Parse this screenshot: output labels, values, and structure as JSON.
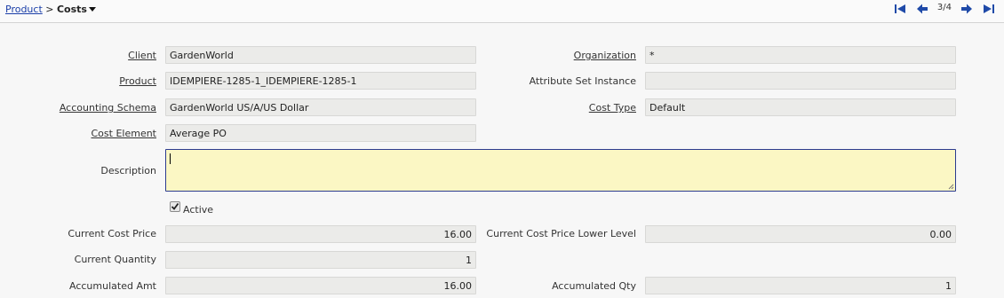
{
  "breadcrumb": {
    "parent": "Product",
    "separator": ">",
    "current": "Costs"
  },
  "navigation": {
    "record_count": "3/4"
  },
  "form": {
    "client": {
      "label": "Client",
      "value": "GardenWorld"
    },
    "organization": {
      "label": "Organization",
      "value": "*"
    },
    "product": {
      "label": "Product",
      "value": "IDEMPIERE-1285-1_IDEMPIERE-1285-1"
    },
    "attribute_set_instance": {
      "label": "Attribute Set Instance",
      "value": ""
    },
    "accounting_schema": {
      "label": "Accounting Schema",
      "value": "GardenWorld US/A/US Dollar"
    },
    "cost_type": {
      "label": "Cost Type",
      "value": "Default"
    },
    "cost_element": {
      "label": "Cost Element",
      "value": "Average PO"
    },
    "description": {
      "label": "Description",
      "value": ""
    },
    "active": {
      "label": "Active",
      "checked": true
    },
    "current_cost_price": {
      "label": "Current Cost Price",
      "value": "16.00"
    },
    "current_cost_price_lower_level": {
      "label": "Current Cost Price Lower Level",
      "value": "0.00"
    },
    "current_quantity": {
      "label": "Current Quantity",
      "value": "1"
    },
    "accumulated_amt": {
      "label": "Accumulated Amt",
      "value": "16.00"
    },
    "accumulated_qty": {
      "label": "Accumulated Qty",
      "value": "1"
    }
  },
  "colors": {
    "link": "#1a3ea8",
    "field_bg": "#ebebe9",
    "description_bg": "#fbf7c4",
    "focus_border": "#2b3a8f",
    "nav_icon": "#1f4aa8"
  },
  "icons": {
    "first": "first-record-icon",
    "prev": "previous-record-icon",
    "next": "next-record-icon",
    "last": "last-record-icon",
    "checkbox": "checkmark-icon"
  }
}
